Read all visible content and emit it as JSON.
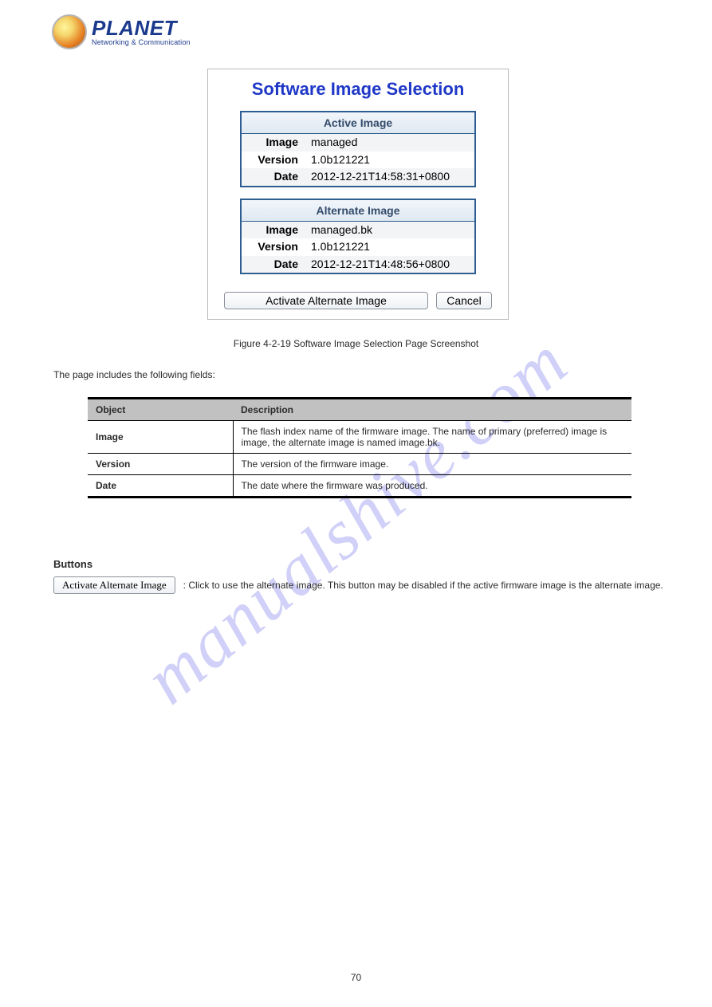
{
  "header": {
    "brand": "PLANET",
    "tagline": "Networking & Communication"
  },
  "watermark": "manualshive.com",
  "panel": {
    "title": "Software Image Selection",
    "activeTable": {
      "heading": "Active Image",
      "rows": [
        {
          "label": "Image",
          "value": "managed"
        },
        {
          "label": "Version",
          "value": "1.0b121221"
        },
        {
          "label": "Date",
          "value": "2012-12-21T14:58:31+0800"
        }
      ]
    },
    "alternateTable": {
      "heading": "Alternate Image",
      "rows": [
        {
          "label": "Image",
          "value": "managed.bk"
        },
        {
          "label": "Version",
          "value": "1.0b121221"
        },
        {
          "label": "Date",
          "value": "2012-12-21T14:48:56+0800"
        }
      ]
    },
    "buttons": {
      "activate": "Activate Alternate Image",
      "cancel": "Cancel"
    }
  },
  "figureCaption": "Figure 4-2-19 Software Image Selection Page Screenshot",
  "sectionLabel": "The page includes the following fields:",
  "descTable": {
    "headers": {
      "object": "Object",
      "description": "Description"
    },
    "rows": [
      {
        "object": "Image",
        "description": "The flash index name of the firmware image. The name of primary (preferred) image is image, the alternate image is named image.bk."
      },
      {
        "object": "Version",
        "description": "The version of the firmware image."
      },
      {
        "object": "Date",
        "description": "The date where the firmware was produced."
      }
    ]
  },
  "buttonsSection": {
    "heading": "Buttons",
    "activateLabel": "Activate Alternate Image",
    "activateCaption": ": Click to use the alternate image. This button may be disabled if the active firmware image is the alternate image."
  },
  "pageNumber": "70"
}
